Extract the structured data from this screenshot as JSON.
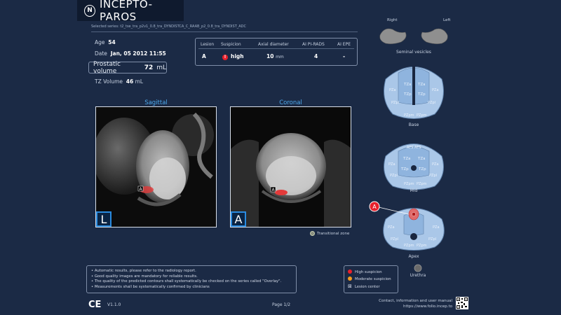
{
  "brand": {
    "logo_letter": "N",
    "name": "INCEPTO-PAROS"
  },
  "series": "Selected series: t2_tse_tra_p2v1_0.8_tra_DYNDISTCA_C_RAAB_p2_0.8_tra_DYNDIST_ADC",
  "patient": {
    "age_label": "Age",
    "age": "54",
    "date_label": "Date",
    "date": "Jan, 05 2012 11:55",
    "pv_label": "Prostatic volume",
    "pv_value": "72",
    "pv_unit": "mL",
    "tz_label": "TZ Volume",
    "tz_value": "46",
    "tz_unit": "mL"
  },
  "lesion_table": {
    "headers": [
      "Lesion",
      "Suspicion",
      "Axial diameter",
      "AI PI-RADS",
      "AI EPE"
    ],
    "row": {
      "lesion": "A",
      "suspicion_icon": "!",
      "suspicion": "high",
      "diameter": "10",
      "diameter_unit": "mm",
      "pirads": "4",
      "epe": "-"
    }
  },
  "views": {
    "sagittal_title": "Sagittal",
    "sagittal_orient": "L",
    "sagittal_marker": "A",
    "coronal_title": "Coronal",
    "coronal_orient": "A",
    "coronal_marker": "A"
  },
  "tz_legend": "Transitional zone",
  "notes": [
    "Automatic results, please refer to the radiology report.",
    "Good quality images are mandatory for reliable results.",
    "The quality of the predicted contours shall systematically be checked on the series called \"Overlay\".",
    "Measurements shall be systematically confirmed by clinicians"
  ],
  "legend": {
    "high": "High suspicion",
    "high_color": "#e8202b",
    "moderate": "Moderate suspicion",
    "moderate_color": "#f39c1f",
    "center": "Lesion center",
    "center_icon": "⊠"
  },
  "footer": {
    "ce": "CE",
    "version": "V1.1.0",
    "page": "Page 1/2",
    "contact_line1": "Contact, information and user manual",
    "contact_line2": "https://www.folio.incep.to"
  },
  "map": {
    "right": "Right",
    "left": "Left",
    "seminal": "Seminal vesicles",
    "base_label": "Base",
    "mid_label": "Mid",
    "apex_label": "Apex",
    "urethra": "Urethra",
    "lesion_marker": "A",
    "zones": {
      "afs": "AFS",
      "tza": "TZa",
      "tzp": "TZp",
      "pza": "PZa",
      "pzpl": "PZpl",
      "pzpm": "PZpm",
      "cz": "CZ",
      "pzpm2": "PZpm"
    }
  }
}
